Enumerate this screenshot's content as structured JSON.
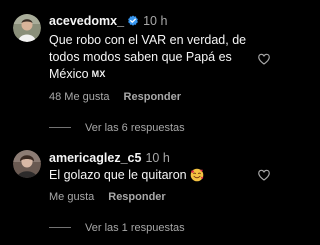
{
  "colors": {
    "background": "#000000",
    "text_primary": "#f5f5f5",
    "text_secondary": "#a8a8a8",
    "verified_blue": "#3897f0",
    "heart_outline": "#a8a8a8"
  },
  "comments": [
    {
      "username": "acevedomx_",
      "verified": true,
      "time": "10 h",
      "text_lines": [
        "Que robo con el VAR en verdad, de",
        "todos modos saben que Papá es",
        "México"
      ],
      "flag_text": "MX",
      "likes_label": "48 Me gusta",
      "reply_label": "Responder",
      "view_replies_label": "Ver las 6 respuestas",
      "like_icon": "heart-outline-icon"
    },
    {
      "username": "americaglez_c5",
      "verified": false,
      "time": "10 h",
      "text_lines": [
        "El golazo que le quitaron"
      ],
      "emoji": "smiling-face-with-hearts",
      "likes_label": "Me gusta",
      "reply_label": "Responder",
      "view_replies_label": "Ver las 1 respuestas",
      "like_icon": "heart-outline-icon"
    }
  ]
}
